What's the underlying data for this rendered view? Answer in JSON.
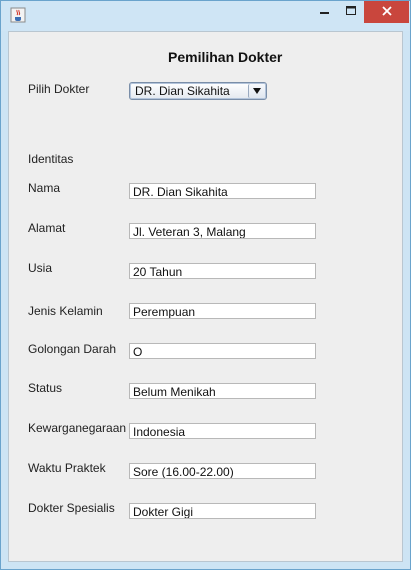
{
  "heading": "Pemilihan Dokter",
  "chooser": {
    "label": "Pilih Dokter",
    "selected": "DR. Dian Sikahita"
  },
  "section_title": "Identitas",
  "fields": [
    {
      "label": "Nama",
      "value": "DR. Dian Sikahita"
    },
    {
      "label": "Alamat",
      "value": "Jl. Veteran 3, Malang"
    },
    {
      "label": "Usia",
      "value": "20 Tahun"
    },
    {
      "label": "Jenis Kelamin",
      "value": "Perempuan"
    },
    {
      "label": "Golongan Darah",
      "value": "O"
    },
    {
      "label": "Status",
      "value": "Belum Menikah"
    },
    {
      "label": "Kewarganegaraan",
      "value": "Indonesia"
    },
    {
      "label": "Waktu Praktek",
      "value": "Sore (16.00-22.00)"
    },
    {
      "label": "Dokter Spesialis",
      "value": "Dokter Gigi"
    }
  ],
  "colors": {
    "close_button": "#c9463d",
    "window_frame": "#cde4f4",
    "content_bg": "#eeeeee"
  },
  "icons": {
    "app": "java-app-icon",
    "minimize": "minimize-icon",
    "maximize": "maximize-icon",
    "close": "close-icon",
    "dropdown": "chevron-down-icon"
  }
}
